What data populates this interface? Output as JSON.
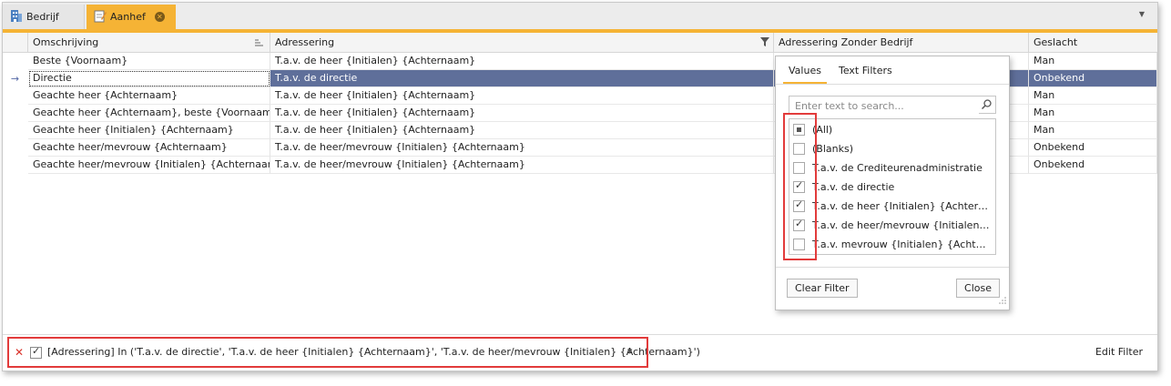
{
  "tabs": [
    {
      "label": "Bedrijf",
      "icon": "building-icon"
    },
    {
      "label": "Aanhef",
      "icon": "edit-document-icon"
    }
  ],
  "colors": {
    "accent": "#f5b335",
    "selection": "#5f6f9a",
    "highlight_box": "#e23b3b"
  },
  "grid": {
    "columns": [
      "Omschrijving",
      "Adressering",
      "Adressering Zonder Bedrijf",
      "Geslacht"
    ],
    "rows": [
      {
        "omschrijving": "Beste {Voornaam}",
        "adressering": "T.a.v. de heer {Initialen} {Achternaam}",
        "zonder_bedrijf": "",
        "geslacht": "Man",
        "selected": false
      },
      {
        "omschrijving": "Directie",
        "adressering": "T.a.v. de directie",
        "zonder_bedrijf": "",
        "geslacht": "Onbekend",
        "selected": true
      },
      {
        "omschrijving": "Geachte heer {Achternaam}",
        "adressering": "T.a.v. de heer {Initialen} {Achternaam}",
        "zonder_bedrijf": "",
        "geslacht": "Man",
        "selected": false
      },
      {
        "omschrijving": "Geachte heer {Achternaam}, beste {Voornaam}",
        "adressering": "T.a.v. de heer {Initialen} {Achternaam}",
        "zonder_bedrijf": "",
        "geslacht": "Man",
        "selected": false
      },
      {
        "omschrijving": "Geachte heer {Initialen} {Achternaam}",
        "adressering": "T.a.v. de heer {Initialen} {Achternaam}",
        "zonder_bedrijf": "",
        "geslacht": "Man",
        "selected": false
      },
      {
        "omschrijving": "Geachte heer/mevrouw {Achternaam}",
        "adressering": "T.a.v. de heer/mevrouw {Initialen} {Achternaam}",
        "zonder_bedrijf": "",
        "geslacht": "Onbekend",
        "selected": false
      },
      {
        "omschrijving": "Geachte heer/mevrouw {Initialen} {Achternaam}",
        "adressering": "T.a.v. de heer/mevrouw {Initialen} {Achternaam}",
        "zonder_bedrijf": "",
        "geslacht": "Onbekend",
        "selected": false
      }
    ]
  },
  "filter_popup": {
    "tabs": [
      "Values",
      "Text Filters"
    ],
    "search_placeholder": "Enter text to search...",
    "items": [
      {
        "label": "(All)",
        "state": "indeterminate"
      },
      {
        "label": "(Blanks)",
        "state": "unchecked"
      },
      {
        "label": "T.a.v. de Crediteurenadministratie",
        "state": "unchecked"
      },
      {
        "label": "T.a.v. de directie",
        "state": "checked"
      },
      {
        "label": "T.a.v. de heer {Initialen} {Achternaam}",
        "state": "checked"
      },
      {
        "label": "T.a.v. de heer/mevrouw {Initialen} {A...",
        "state": "checked"
      },
      {
        "label": "T.a.v. mevrouw {Initialen} {Achternaa...",
        "state": "unchecked"
      }
    ],
    "clear_filter_label": "Clear Filter",
    "close_label": "Close"
  },
  "filter_bar": {
    "expression": "[Adressering] In ('T.a.v. de directie', 'T.a.v. de heer {Initialen} {Achternaam}', 'T.a.v. de heer/mevrouw {Initialen} {Achternaam}')",
    "enabled": true,
    "edit_filter_label": "Edit Filter"
  }
}
